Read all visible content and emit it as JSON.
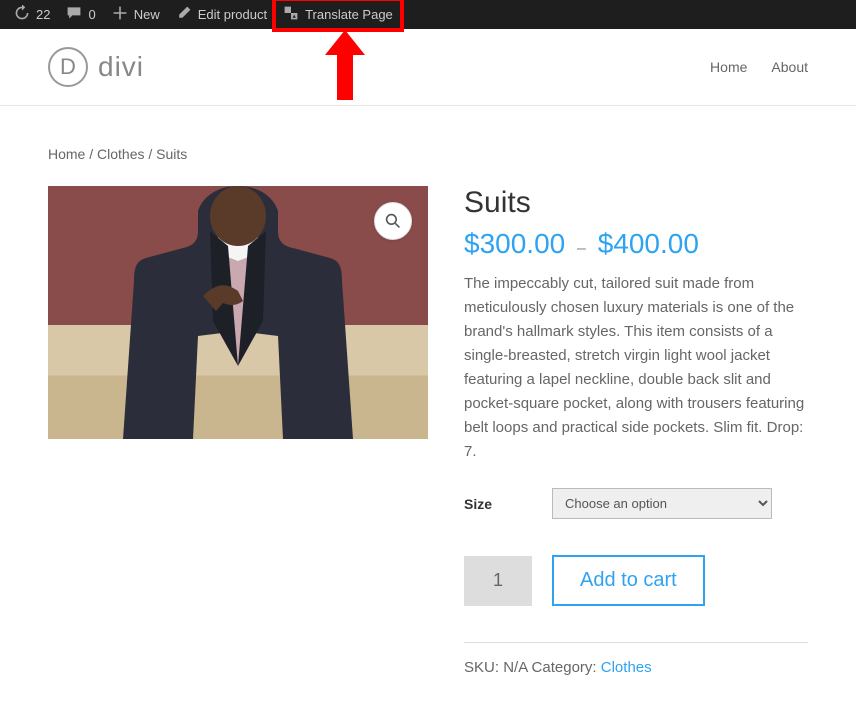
{
  "admin_bar": {
    "updates_count": "22",
    "comments_count": "0",
    "new_label": "New",
    "edit_label": "Edit product",
    "translate_label": "Translate Page"
  },
  "logo": {
    "letter": "D",
    "text": "divi"
  },
  "nav": {
    "home": "Home",
    "about": "About"
  },
  "breadcrumb": {
    "home": "Home",
    "clothes": "Clothes",
    "current": "Suits"
  },
  "product": {
    "title": "Suits",
    "currency": "$",
    "price_min": "300.00",
    "price_sep": "–",
    "price_max": "400.00",
    "description": "The impeccably cut, tailored suit made from meticulously chosen luxury materials is one of the brand's hallmark styles. This item consists of a single-breasted, stretch virgin light wool jacket featuring a lapel neckline, double back slit and pocket-square pocket, along with trousers featuring belt loops and practical side pockets. Slim fit. Drop: 7.",
    "size_label": "Size",
    "size_placeholder": "Choose an option",
    "quantity": "1",
    "add_label": "Add to cart",
    "sku_label": "SKU:",
    "sku_value": "N/A",
    "category_label": "Category:",
    "category_value": "Clothes"
  }
}
